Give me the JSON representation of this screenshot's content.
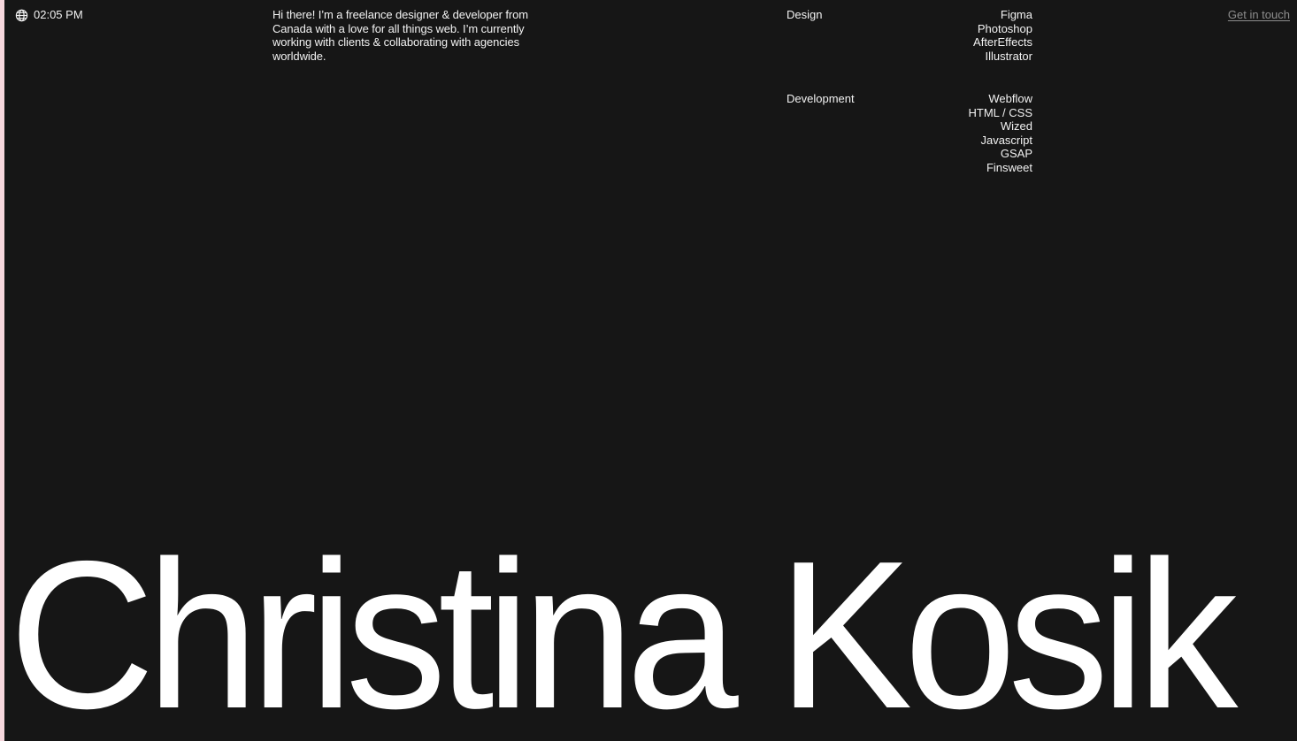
{
  "header": {
    "time": "02:05 PM",
    "time_icon": "globe-icon",
    "contact_label": "Get in touch"
  },
  "intro": {
    "text": "Hi there! I’m a freelance designer & developer from Canada with a love for all things web. I’m currently working with clients & collaborating with agencies worldwide."
  },
  "skills": {
    "design": {
      "label": "Design",
      "items": [
        "Figma",
        "Photoshop",
        "AfterEffects",
        "Illustrator"
      ]
    },
    "development": {
      "label": "Development",
      "items": [
        "Webflow",
        "HTML / CSS",
        "Wized",
        "Javascript",
        "GSAP",
        "Finsweet"
      ]
    }
  },
  "hero": {
    "name": "Christina Kosik"
  },
  "colors": {
    "background": "#161616",
    "text": "#f2f2f2",
    "muted_link": "#8d8d8d",
    "edge_accent": "#f6d7dd"
  }
}
